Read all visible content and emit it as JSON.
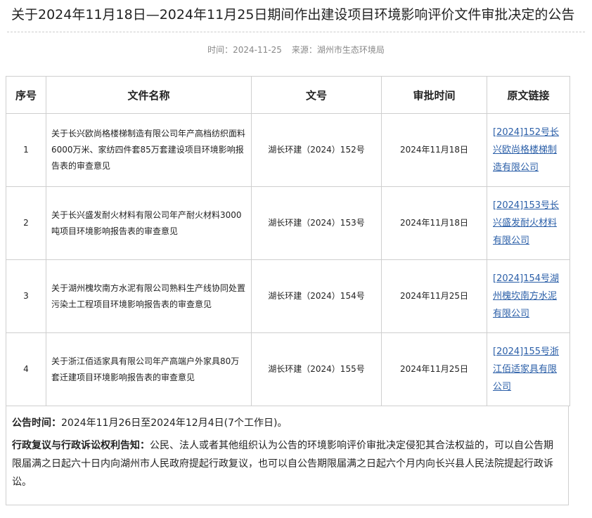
{
  "page": {
    "title": "关于2024年11月18日—2024年11月25日期间作出建设项目环境影响评价文件审批决定的公告"
  },
  "meta": {
    "time_label": "时间：",
    "time_value": "2024-11-25",
    "source_label": "来源：",
    "source_value": "湖州市生态环境局"
  },
  "table": {
    "headers": [
      "序号",
      "文件名称",
      "文号",
      "审批时间",
      "原文链接"
    ],
    "rows": [
      {
        "no": "1",
        "title": "关于长兴欧尚格楼梯制造有限公司年产高档纺织面料6000万米、家纺四件套85万套建设项目环境影响报告表的审查意见",
        "doc_no": "湖长环建（2024）152号",
        "date": "2024年11月18日",
        "link": "[2024]152号长兴欧尚格楼梯制造有限公司"
      },
      {
        "no": "2",
        "title": "关于长兴盛发耐火材料有限公司年产耐火材料3000吨项目环境影响报告表的审查意见",
        "doc_no": "湖长环建（2024）153号",
        "date": "2024年11月18日",
        "link": "[2024]153号长兴盛发耐火材料有限公司"
      },
      {
        "no": "3",
        "title": "关于湖州槐坎南方水泥有限公司熟料生产线协同处置污染土工程项目环境影响报告表的审查意见",
        "doc_no": "湖长环建（2024）154号",
        "date": "2024年11月25日",
        "link": "[2024]154号湖州槐坎南方水泥有限公司"
      },
      {
        "no": "4",
        "title": "关于浙江佰适家具有限公司年产高端户外家具80万套迁建项目环境影响报告表的审查意见",
        "doc_no": "湖长环建（2024）155号",
        "date": "2024年11月25日",
        "link": "[2024]155号浙江佰适家具有限公司"
      }
    ]
  },
  "notice": {
    "period_label": "公告时间：",
    "period_text": "2024年11月26日至2024年12月4日(7个工作日)。",
    "rights_label": "行政复议与行政诉讼权利告知：",
    "rights_text": "公民、法人或者其他组织认为公告的环境影响评价审批决定侵犯其合法权益的，可以自公告期限届满之日起六十日内向湖州市人民政府提起行政复议，也可以自公告期限届满之日起六个月内向长兴县人民法院提起行政诉讼。"
  }
}
